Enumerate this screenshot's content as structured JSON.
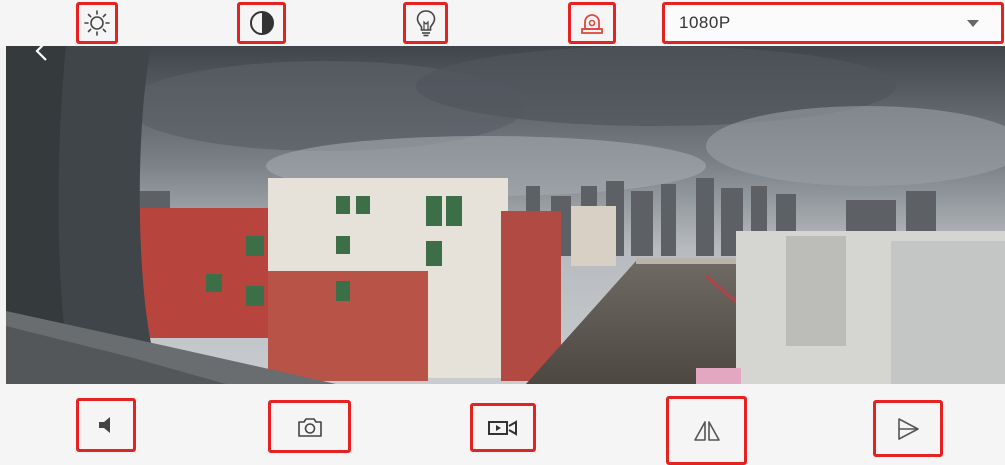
{
  "toolbar": {
    "brightness_icon": "sun-icon",
    "contrast_icon": "contrast-icon",
    "light_icon": "lightbulb-icon",
    "alarm_icon": "siren-icon"
  },
  "resolution": {
    "selected": "1080P"
  },
  "controls": {
    "audio_icon": "speaker-icon",
    "snapshot_icon": "camera-icon",
    "record_icon": "video-record-icon",
    "flip_vertical_icon": "flip-vertical-icon",
    "flip_horizontal_icon": "flip-horizontal-icon"
  },
  "colors": {
    "highlight": "#e52222",
    "icon": "#444444",
    "background": "#f5f5f5"
  }
}
